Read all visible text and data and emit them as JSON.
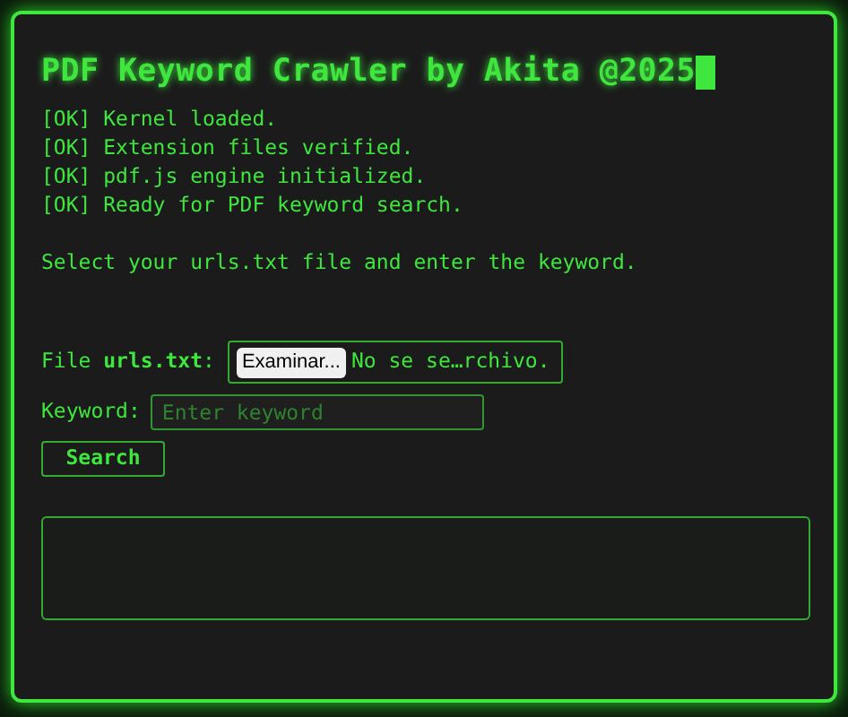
{
  "title": "PDF Keyword Crawler by Akita @2025",
  "log": [
    "[OK] Kernel loaded.",
    "[OK] Extension files verified.",
    "[OK] pdf.js engine initialized.",
    "[OK] Ready for PDF keyword search."
  ],
  "instruction": "Select your urls.txt file and enter the keyword.",
  "file_field": {
    "label": "File **urls.txt**:",
    "button": "Examinar...",
    "status": "No se se…rchivo."
  },
  "keyword_field": {
    "label": "Keyword:",
    "placeholder": "Enter keyword"
  },
  "buttons": [
    "Search"
  ]
}
